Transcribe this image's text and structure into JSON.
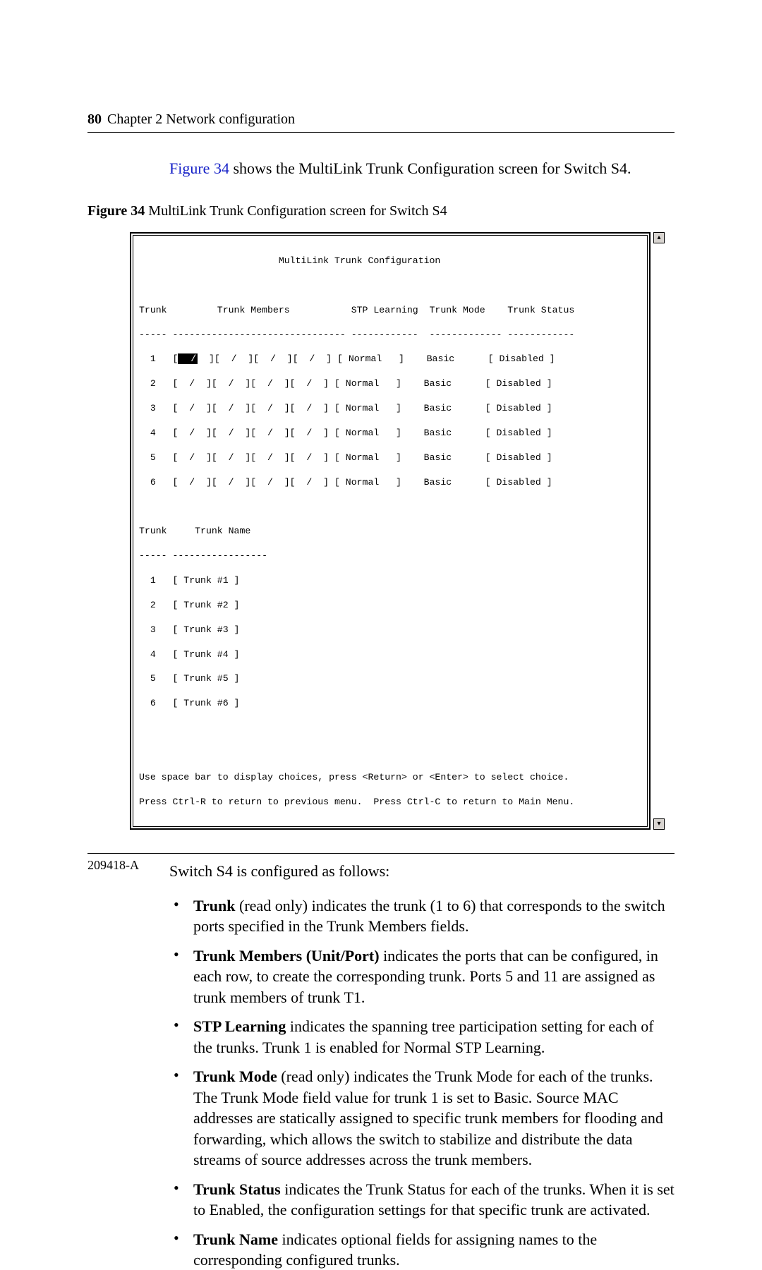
{
  "header": {
    "page_number": "80",
    "chapter": "Chapter 2  Network configuration"
  },
  "intro": {
    "link_text": "Figure 34",
    "rest": " shows the MultiLink Trunk Configuration screen for Switch S4."
  },
  "figure_caption": {
    "number": "Figure 34",
    "title": "   MultiLink Trunk Configuration screen for Switch S4"
  },
  "terminal": {
    "title_line": "                         MultiLink Trunk Configuration",
    "header_row": "Trunk         Trunk Members           STP Learning  Trunk Mode    Trunk Status",
    "rule1": "----- ------------------------------- ------------  ------------- ------------",
    "rows": [
      {
        "pre": "  1   [",
        "inv": "  /",
        "post": "  ][  /  ][  /  ][  /  ] [ Normal   ]    Basic      [ Disabled ]"
      },
      {
        "pre": "  2   [  /  ][  /  ][  /  ][  /  ] [ Normal   ]    Basic      [ Disabled ]"
      },
      {
        "pre": "  3   [  /  ][  /  ][  /  ][  /  ] [ Normal   ]    Basic      [ Disabled ]"
      },
      {
        "pre": "  4   [  /  ][  /  ][  /  ][  /  ] [ Normal   ]    Basic      [ Disabled ]"
      },
      {
        "pre": "  5   [  /  ][  /  ][  /  ][  /  ] [ Normal   ]    Basic      [ Disabled ]"
      },
      {
        "pre": "  6   [  /  ][  /  ][  /  ][  /  ] [ Normal   ]    Basic      [ Disabled ]"
      }
    ],
    "names_header": "Trunk     Trunk Name",
    "rule2": "----- -----------------",
    "names": [
      "  1   [ Trunk #1 ]",
      "  2   [ Trunk #2 ]",
      "  3   [ Trunk #3 ]",
      "  4   [ Trunk #4 ]",
      "  5   [ Trunk #5 ]",
      "  6   [ Trunk #6 ]"
    ],
    "help1": "Use space bar to display choices, press <Return> or <Enter> to select choice.",
    "help2": "Press Ctrl-R to return to previous menu.  Press Ctrl-C to return to Main Menu."
  },
  "body": {
    "lead": "Switch S4 is configured as follows:",
    "items": [
      {
        "bold": "Trunk",
        "text": " (read only) indicates the trunk (1 to 6) that corresponds to the switch ports specified in the Trunk Members fields."
      },
      {
        "bold": "Trunk Members (Unit/Port)",
        "text": " indicates the ports that can be configured, in each row, to create the corresponding trunk. Ports 5 and 11 are assigned as trunk members of trunk T1."
      },
      {
        "bold": "STP Learning",
        "text": " indicates the spanning tree participation setting for each of the trunks. Trunk 1 is enabled for Normal STP Learning."
      },
      {
        "bold": "Trunk Mode",
        "text": " (read only) indicates the Trunk Mode for each of the trunks. The Trunk Mode field value for trunk 1 is set to Basic. Source MAC addresses are statically assigned to specific trunk members for flooding and forwarding, which allows the switch to stabilize and distribute the data streams of source addresses across the trunk members."
      },
      {
        "bold": "Trunk Status",
        "text": " indicates the Trunk Status for each of the trunks. When it is set to Enabled, the configuration settings for that specific trunk are activated."
      },
      {
        "bold": "Trunk Name",
        "text": " indicates optional fields for assigning names to the corresponding configured trunks."
      }
    ]
  },
  "footer": {
    "doc_id": "209418-A"
  }
}
